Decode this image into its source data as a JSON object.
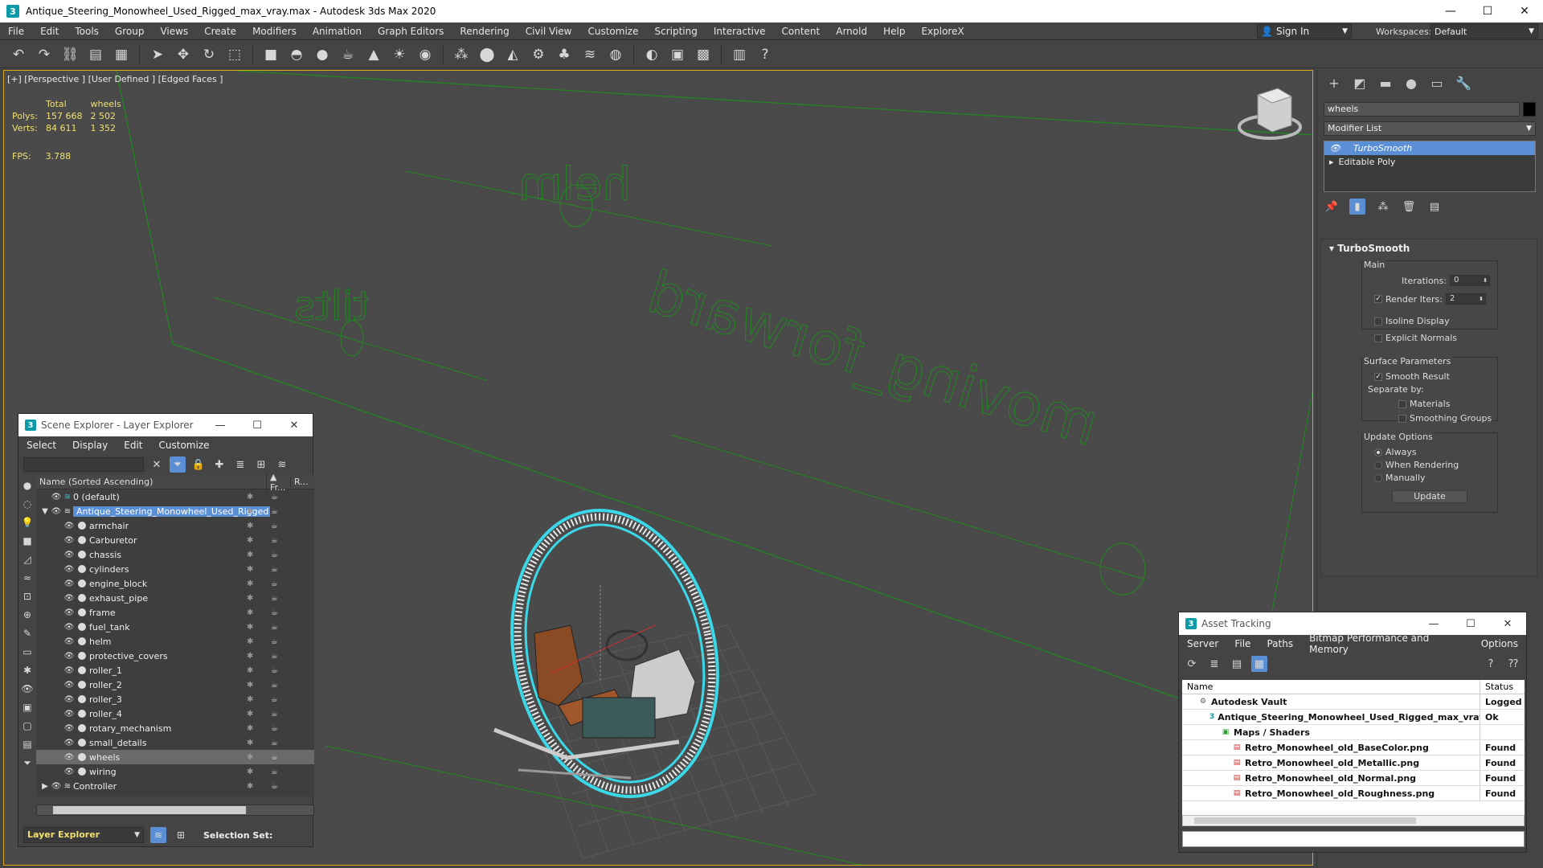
{
  "window": {
    "title": "Antique_Steering_Monowheel_Used_Rigged_max_vray.max - Autodesk 3ds Max 2020",
    "app_icon": "3",
    "controls": {
      "minimize": "—",
      "maximize": "☐",
      "close": "✕"
    }
  },
  "menubar": {
    "items": [
      "File",
      "Edit",
      "Tools",
      "Group",
      "Views",
      "Create",
      "Modifiers",
      "Animation",
      "Graph Editors",
      "Rendering",
      "Civil View",
      "Customize",
      "Scripting",
      "Interactive",
      "Content",
      "Arnold",
      "Help",
      "ExploreX"
    ],
    "signin_label": "Sign In",
    "workspaces_label": "Workspaces:",
    "workspace_value": "Default"
  },
  "viewport": {
    "label": "[+] [Perspective ] [User Defined ] [Edged Faces ]",
    "stats": {
      "col_total": "Total",
      "col_selected": "wheels",
      "polys_label": "Polys:",
      "polys_total": "157 668",
      "polys_sel": "2 502",
      "verts_label": "Verts:",
      "verts_total": "84 611",
      "verts_sel": "1 352",
      "fps_label": "FPS:",
      "fps_value": "3.788"
    },
    "scene_text": {
      "helm": "helm",
      "tilts": "tilts",
      "forward": "moving_forward"
    }
  },
  "command_panel": {
    "object_name": "wheels",
    "modifier_list": "Modifier List",
    "stack": [
      "TurboSmooth",
      "Editable Poly"
    ],
    "rollout": {
      "title": "TurboSmooth",
      "main_label": "Main",
      "iterations_label": "Iterations:",
      "iterations_value": "0",
      "render_iters_label": "Render Iters:",
      "render_iters_value": "2",
      "isoline": "Isoline Display",
      "explicit": "Explicit Normals",
      "surface_label": "Surface Parameters",
      "smooth_result": "Smooth Result",
      "separate_by": "Separate by:",
      "materials": "Materials",
      "smoothing_groups": "Smoothing Groups",
      "update_label": "Update Options",
      "always": "Always",
      "when_rendering": "When Rendering",
      "manually": "Manually",
      "update_button": "Update"
    }
  },
  "scene_explorer": {
    "title": "Scene Explorer - Layer Explorer",
    "menu": [
      "Select",
      "Display",
      "Edit",
      "Customize"
    ],
    "col_name": "Name (Sorted Ascending)",
    "col_fr": "▲ Fr...",
    "col_r": "R...",
    "rows": [
      {
        "name": "0 (default)",
        "level": 1
      },
      {
        "name": "Antique_Steering_Monowheel_Used_Rigged",
        "level": 0
      },
      {
        "name": "armchair",
        "level": 2
      },
      {
        "name": "Carburetor",
        "level": 2
      },
      {
        "name": "chassis",
        "level": 2
      },
      {
        "name": "cylinders",
        "level": 2
      },
      {
        "name": "engine_block",
        "level": 2
      },
      {
        "name": "exhaust_pipe",
        "level": 2
      },
      {
        "name": "frame",
        "level": 2
      },
      {
        "name": "fuel_tank",
        "level": 2
      },
      {
        "name": "helm",
        "level": 2
      },
      {
        "name": "protective_covers",
        "level": 2
      },
      {
        "name": "roller_1",
        "level": 2
      },
      {
        "name": "roller_2",
        "level": 2
      },
      {
        "name": "roller_3",
        "level": 2
      },
      {
        "name": "roller_4",
        "level": 2
      },
      {
        "name": "rotary_mechanism",
        "level": 2
      },
      {
        "name": "small_details",
        "level": 2
      },
      {
        "name": "wheels",
        "level": 2
      },
      {
        "name": "wiring",
        "level": 2
      },
      {
        "name": "Controller",
        "level": 0
      }
    ],
    "mode": "Layer Explorer",
    "selection_set": "Selection Set:"
  },
  "asset_tracking": {
    "title": "Asset Tracking",
    "menu": [
      "Server",
      "File",
      "Paths",
      "Bitmap Performance and Memory",
      "Options"
    ],
    "col_name": "Name",
    "col_status": "Status",
    "rows": [
      {
        "name": "Autodesk Vault",
        "status": "Logged O",
        "indent": 1
      },
      {
        "name": "Antique_Steering_Monowheel_Used_Rigged_max_vray.max",
        "status": "Ok",
        "indent": 2
      },
      {
        "name": "Maps / Shaders",
        "status": "",
        "indent": 3
      },
      {
        "name": "Retro_Monowheel_old_BaseColor.png",
        "status": "Found",
        "indent": 4
      },
      {
        "name": "Retro_Monowheel_old_Metallic.png",
        "status": "Found",
        "indent": 4
      },
      {
        "name": "Retro_Monowheel_old_Normal.png",
        "status": "Found",
        "indent": 4
      },
      {
        "name": "Retro_Monowheel_old_Roughness.png",
        "status": "Found",
        "indent": 4
      }
    ]
  },
  "colors": {
    "accent": "#5a8fd6",
    "stats_yellow": "#f0e070",
    "viewport_border": "#d8a81c",
    "wire_cyan": "#3ad8e8",
    "helper_green": "#1f8a1f"
  }
}
